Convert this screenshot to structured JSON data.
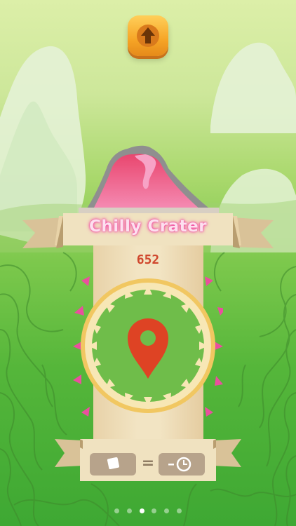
{
  "level": {
    "name": "Chilly Crater",
    "score": "652"
  },
  "page_indicator": {
    "count": 6,
    "active_index": 2
  },
  "colors": {
    "title_glow": "#f24aa3",
    "score_text": "#d0472d",
    "marker": "#de4324",
    "ring": "#f1c761"
  },
  "icons": {
    "top_button": "up-arrow-icon",
    "location": "map-pin-icon",
    "cost_left": "cube-icon",
    "cost_right": "clock-minus-icon"
  }
}
